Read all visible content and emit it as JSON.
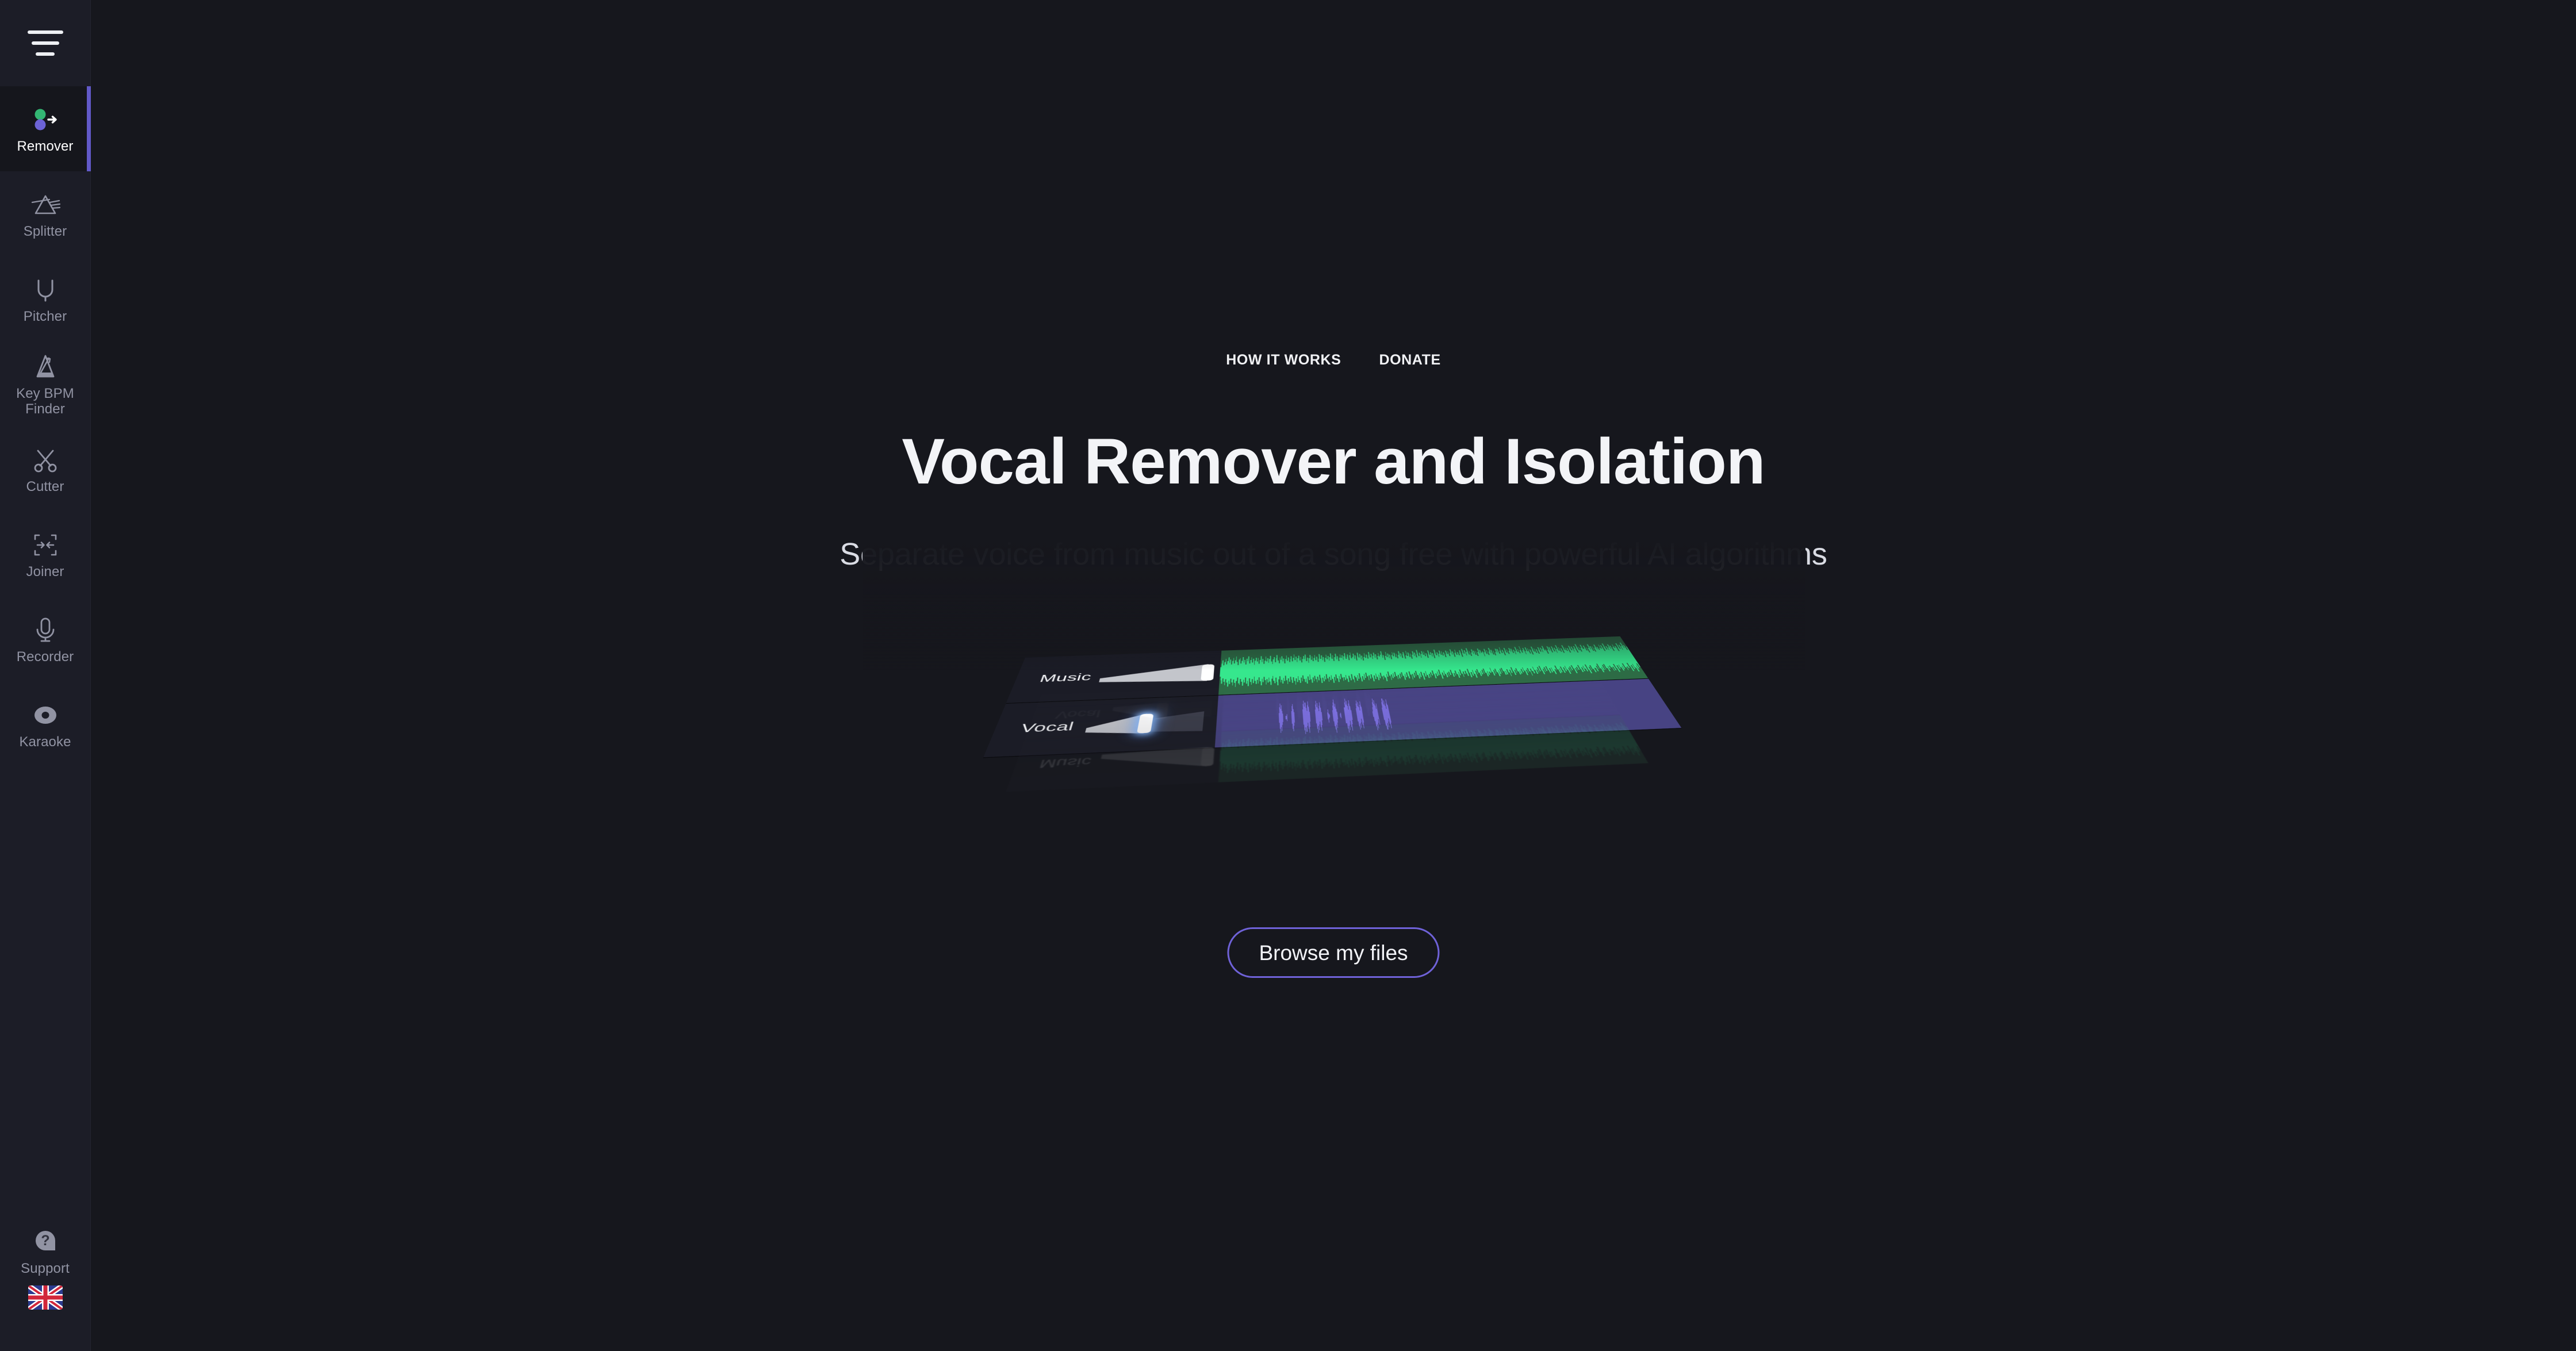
{
  "app": {
    "background_color": "#16171d",
    "sidebar_color": "#1c1d27",
    "accent_color": "#6159c8"
  },
  "sidebar": {
    "menu_button_name": "hamburger-menu",
    "items": [
      {
        "id": "remover",
        "label": "Remover",
        "icon": "remover-icon",
        "active": true
      },
      {
        "id": "splitter",
        "label": "Splitter",
        "icon": "prism-icon",
        "active": false
      },
      {
        "id": "pitcher",
        "label": "Pitcher",
        "icon": "tuning-fork-icon",
        "active": false
      },
      {
        "id": "keybpm",
        "label": "Key BPM Finder",
        "icon": "metronome-icon",
        "active": false
      },
      {
        "id": "cutter",
        "label": "Cutter",
        "icon": "scissors-icon",
        "active": false
      },
      {
        "id": "joiner",
        "label": "Joiner",
        "icon": "join-arrows-icon",
        "active": false
      },
      {
        "id": "recorder",
        "label": "Recorder",
        "icon": "microphone-icon",
        "active": false
      },
      {
        "id": "karaoke",
        "label": "Karaoke",
        "icon": "vinyl-record-icon",
        "active": false
      }
    ],
    "bottom": [
      {
        "id": "support",
        "label": "Support",
        "icon": "question-mark-icon"
      }
    ],
    "language": {
      "label": "English",
      "icon": "uk-flag-icon"
    }
  },
  "topnav": {
    "links": [
      {
        "id": "how-it-works",
        "label": "HOW IT WORKS"
      },
      {
        "id": "donate",
        "label": "DONATE"
      }
    ]
  },
  "hero": {
    "title": "Vocal Remover and Isolation",
    "subtitle": "Separate voice from music out of a song free with powerful AI algorithms",
    "browse_button_label": "Browse my files"
  },
  "illustration": {
    "name": "track-separation-preview",
    "tracks": [
      {
        "id": "music",
        "label": "Music",
        "track_color": "#2d6b45",
        "wave_color": "#36e78d",
        "volume_percent": 100,
        "slider_highlighted": false
      },
      {
        "id": "vocal",
        "label": "Vocal",
        "track_color": "#474383",
        "wave_color": "#7c6fe0",
        "volume_percent": 50,
        "slider_highlighted": true
      }
    ],
    "music_wave": [
      22,
      38,
      54,
      31,
      46,
      60,
      35,
      50,
      68,
      41,
      57,
      33,
      49,
      64,
      37,
      52,
      70,
      44,
      29,
      55,
      62,
      36,
      48,
      66,
      40,
      53,
      31,
      58,
      45,
      69,
      34,
      51,
      63,
      39,
      56,
      28,
      47,
      61,
      43,
      59,
      32,
      50,
      67,
      38,
      54,
      30,
      46,
      65,
      42,
      57,
      35,
      52,
      68,
      40,
      27,
      49,
      60,
      36,
      55,
      71,
      44,
      31,
      58,
      47,
      63,
      39,
      53,
      29,
      50,
      66,
      41,
      57,
      34,
      48,
      62,
      37,
      54,
      70,
      43,
      59,
      33,
      51,
      64,
      40,
      56,
      30,
      47,
      61,
      45,
      68,
      36,
      52,
      28,
      49,
      65,
      42,
      58,
      34,
      50,
      63,
      39,
      55,
      31,
      46,
      67,
      44,
      60,
      37,
      53,
      29,
      48,
      64,
      41,
      57,
      35,
      51,
      69,
      43,
      59,
      32,
      50,
      66,
      38,
      54,
      30,
      47,
      62,
      45,
      58,
      36,
      52,
      68,
      40,
      49,
      61,
      33,
      56,
      70,
      42,
      48,
      64,
      39,
      55,
      31,
      50,
      67,
      44,
      60,
      35,
      53,
      29,
      46,
      63,
      41,
      57,
      37,
      52,
      69,
      43,
      59,
      34,
      50,
      65,
      40,
      56,
      32,
      48,
      62,
      45,
      54,
      70,
      38,
      51,
      28,
      47,
      66,
      42,
      58,
      36,
      53,
      31,
      49,
      64,
      44,
      60,
      39,
      55,
      33,
      50,
      68,
      41,
      57,
      35,
      52,
      62,
      30,
      46,
      67,
      43,
      59,
      37,
      54,
      29,
      48,
      65,
      42,
      58,
      34,
      51,
      70,
      40,
      56,
      32,
      49,
      63,
      45,
      60,
      38,
      53,
      31,
      47,
      66,
      44,
      57,
      36,
      52,
      28,
      50,
      69,
      41,
      55,
      33,
      48,
      64,
      43,
      59,
      39,
      54,
      30,
      46,
      62,
      45,
      58,
      35,
      51,
      68,
      42,
      56,
      31,
      49,
      65,
      40,
      53,
      37,
      50,
      61,
      29,
      47,
      67,
      44,
      60,
      34,
      52,
      70,
      38,
      55,
      32,
      48,
      63,
      41,
      57,
      36,
      54,
      30,
      50,
      66,
      43,
      59,
      45,
      51,
      28,
      47,
      64,
      39,
      56,
      33,
      49,
      68,
      42,
      58,
      35,
      53,
      31,
      46,
      62,
      44,
      60,
      37,
      52,
      69,
      40,
      55,
      29,
      48,
      65,
      41,
      57,
      34,
      50,
      63,
      45,
      59,
      38,
      54,
      32,
      47,
      67,
      43,
      56,
      36,
      51,
      70,
      39,
      49,
      61,
      30,
      46,
      64,
      44,
      58,
      33,
      52,
      28,
      50,
      66,
      42,
      57,
      35,
      53,
      31,
      48,
      62,
      40,
      59,
      37,
      54,
      68,
      45,
      51,
      29,
      47,
      65,
      43,
      60,
      34,
      50,
      63,
      39,
      56,
      32,
      49,
      69,
      41,
      58,
      36,
      52,
      30,
      46,
      67,
      44,
      55,
      38,
      53,
      31,
      50,
      64,
      42,
      59,
      35,
      48,
      61,
      29,
      54,
      70,
      40,
      57,
      33,
      51,
      66,
      45,
      47,
      62,
      37,
      52,
      28,
      49,
      68,
      43,
      58,
      34,
      56,
      30,
      50,
      65,
      41,
      53,
      39,
      47,
      63,
      44,
      60,
      32,
      51,
      69,
      38,
      55,
      36,
      48,
      64,
      42,
      57,
      31,
      50,
      62,
      45,
      54,
      29,
      46,
      67,
      40,
      59,
      35,
      52,
      70,
      43,
      56,
      33,
      49,
      61
    ],
    "vocal_wave": [
      0,
      0,
      0,
      0,
      0,
      0,
      0,
      0,
      0,
      0,
      0,
      0,
      0,
      0,
      0,
      0,
      0,
      0,
      0,
      0,
      0,
      0,
      0,
      0,
      0,
      0,
      0,
      0,
      0,
      0,
      0,
      0,
      0,
      0,
      0,
      0,
      0,
      0,
      0,
      0,
      0,
      0,
      0,
      0,
      0,
      0,
      0,
      0,
      0,
      0,
      0,
      0,
      0,
      0,
      0,
      0,
      0,
      0,
      0,
      0,
      0,
      0,
      0,
      0,
      0,
      0,
      0,
      0,
      0,
      0,
      0,
      0,
      0,
      0,
      0,
      0,
      0,
      0,
      0,
      0,
      0,
      0,
      0,
      0,
      0,
      0,
      0,
      0,
      0,
      0,
      0,
      0,
      0,
      0,
      0,
      0,
      0,
      0,
      0,
      0,
      20,
      45,
      62,
      38,
      55,
      30,
      18,
      0,
      0,
      0,
      0,
      8,
      14,
      0,
      0,
      0,
      0,
      0,
      0,
      0,
      26,
      48,
      58,
      35,
      22,
      0,
      0,
      0,
      0,
      0,
      0,
      0,
      0,
      0,
      0,
      0,
      0,
      0,
      0,
      32,
      56,
      70,
      44,
      62,
      38,
      25,
      50,
      66,
      42,
      20,
      0,
      0,
      0,
      0,
      0,
      0,
      0,
      0,
      0,
      30,
      52,
      68,
      40,
      58,
      34,
      22,
      46,
      60,
      36,
      18,
      0,
      0,
      0,
      0,
      0,
      0,
      0,
      0,
      14,
      28,
      10,
      6,
      0,
      0,
      0,
      0,
      0,
      24,
      44,
      58,
      70,
      38,
      52,
      30,
      16,
      0,
      0,
      0,
      0,
      8,
      12,
      0,
      0,
      0,
      0,
      0,
      0,
      34,
      56,
      72,
      46,
      62,
      40,
      24,
      50,
      64,
      38,
      20,
      0,
      0,
      0,
      0,
      0,
      0,
      0,
      0,
      28,
      48,
      62,
      36,
      54,
      32,
      18,
      42,
      58,
      34,
      0,
      0,
      0,
      0,
      0,
      0,
      0,
      0,
      0,
      0,
      0,
      0,
      0,
      0,
      0,
      0,
      12,
      30,
      52,
      68,
      44,
      60,
      36,
      22,
      46,
      0,
      0,
      0,
      0,
      0,
      0,
      0,
      0,
      26,
      50,
      66,
      40,
      58,
      34,
      20,
      44,
      62,
      38,
      0,
      0,
      0,
      0,
      0,
      0,
      0,
      0,
      0,
      0,
      0,
      0,
      0,
      0,
      0,
      0,
      0,
      0,
      0,
      0,
      0,
      0,
      0,
      0,
      0,
      0,
      0,
      0,
      0,
      0,
      0,
      0,
      0,
      0,
      0,
      0,
      0,
      0,
      0,
      0,
      0,
      0,
      0,
      0,
      0,
      0,
      0,
      0,
      0,
      0,
      0,
      0,
      0,
      0,
      0,
      0,
      0,
      0,
      0,
      0,
      0,
      0,
      0,
      0,
      0,
      0,
      0,
      0,
      0,
      0,
      0,
      0,
      0,
      0,
      0,
      0,
      0,
      0,
      0,
      0,
      0,
      0,
      0,
      0,
      0,
      0,
      0,
      0,
      0,
      0,
      0,
      0,
      0,
      0,
      0,
      0,
      0,
      0,
      0,
      0,
      0,
      0,
      0,
      0,
      0,
      0,
      0,
      0,
      0,
      0,
      0,
      0,
      0,
      0,
      0,
      0,
      0,
      0,
      0,
      0,
      0,
      0,
      0,
      0,
      0,
      0,
      0,
      0,
      0,
      0,
      0,
      0,
      0,
      0,
      0,
      0,
      0,
      0,
      0,
      0,
      0,
      0,
      0,
      0,
      0,
      0,
      0,
      0,
      0,
      0,
      0,
      0,
      0,
      0,
      0,
      0,
      0,
      0,
      0,
      0,
      0,
      0,
      0,
      0,
      0,
      0,
      0,
      0,
      0,
      0,
      0,
      0,
      0,
      0,
      0,
      0,
      0,
      0,
      0,
      0,
      0,
      0,
      0,
      0,
      0,
      0,
      0,
      0,
      0,
      0,
      0,
      0,
      0,
      0,
      0,
      0,
      0,
      0,
      0,
      0,
      0,
      0,
      0,
      0,
      0,
      0,
      0,
      0,
      0,
      0,
      0,
      0,
      0,
      0,
      0,
      0,
      0,
      0,
      0,
      0,
      0,
      0,
      0,
      0,
      0,
      0,
      0,
      0,
      0,
      0,
      0,
      0,
      0,
      0,
      0,
      0,
      0,
      0,
      0,
      0,
      0,
      0,
      0,
      0,
      0,
      0,
      0,
      0,
      0,
      0,
      0,
      0,
      0,
      0,
      0,
      0,
      0,
      0,
      0,
      0,
      0,
      0,
      0,
      0,
      0,
      0,
      0,
      0,
      0,
      0,
      0,
      0,
      0,
      0,
      0,
      0,
      0,
      0,
      0,
      0,
      0,
      0,
      0,
      0,
      0,
      0,
      0,
      0,
      0,
      0,
      0,
      0,
      0,
      0,
      0,
      0,
      0,
      0,
      0,
      0,
      0,
      0,
      0,
      0,
      0,
      0,
      0,
      0,
      0,
      0,
      0,
      0,
      0,
      0,
      0,
      0,
      0,
      0,
      0,
      0,
      0,
      0,
      0,
      0,
      0,
      0,
      0,
      0,
      0,
      0,
      0,
      0,
      0,
      0,
      0,
      0,
      0,
      0,
      0,
      0,
      0,
      0,
      0,
      0,
      0,
      0,
      0,
      0,
      0,
      0,
      0,
      0,
      0,
      0,
      0,
      0,
      0,
      0,
      0,
      0,
      0,
      0,
      0,
      0,
      0,
      0,
      0,
      0,
      0,
      0,
      0,
      0,
      0,
      0,
      0,
      0,
      0,
      0,
      0,
      0,
      0,
      0,
      0,
      0,
      0,
      0,
      0,
      0,
      0,
      0,
      0,
      0,
      0,
      0,
      0,
      0,
      0,
      0,
      0,
      0,
      0,
      0,
      0,
      0,
      0,
      0,
      0,
      0,
      0,
      0,
      0,
      0,
      0,
      0,
      0,
      0,
      0,
      0,
      0,
      0,
      0,
      0,
      0,
      0,
      0,
      0,
      0,
      0,
      0,
      0,
      0,
      0,
      0,
      0,
      0,
      0,
      0,
      0,
      0,
      0,
      0,
      0,
      0,
      0,
      0,
      0,
      0,
      0,
      0,
      0,
      0,
      0,
      0,
      0,
      0,
      0,
      0
    ]
  }
}
